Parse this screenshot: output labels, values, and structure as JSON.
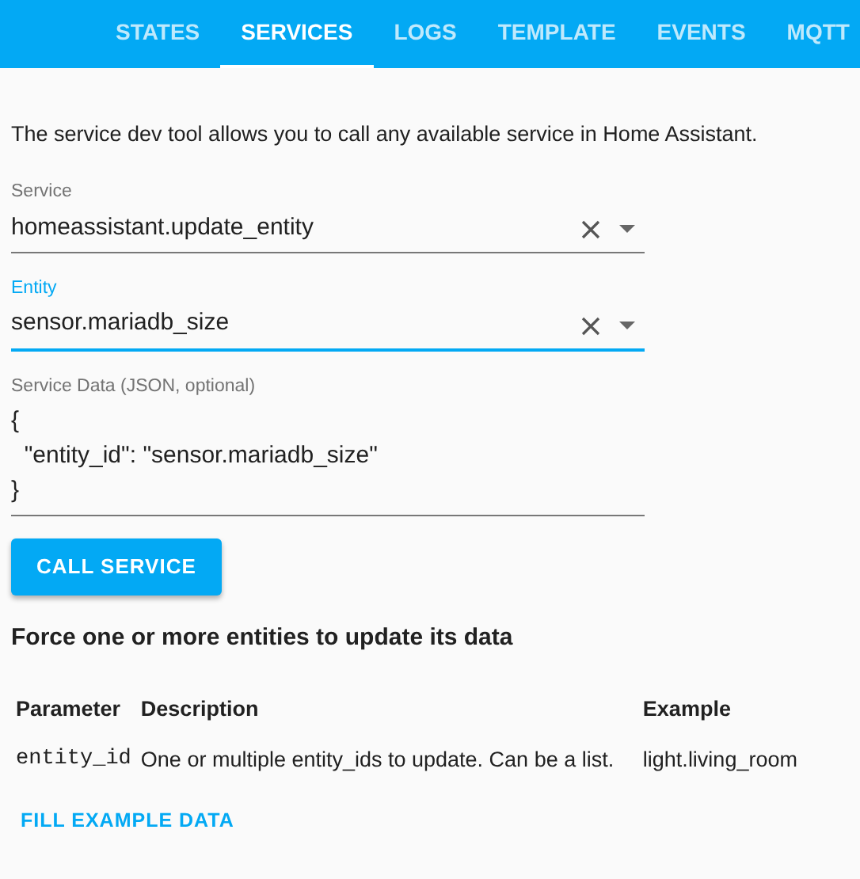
{
  "tabs": [
    {
      "label": "STATES",
      "selected": false
    },
    {
      "label": "SERVICES",
      "selected": true
    },
    {
      "label": "LOGS",
      "selected": false
    },
    {
      "label": "TEMPLATE",
      "selected": false
    },
    {
      "label": "EVENTS",
      "selected": false
    },
    {
      "label": "MQTT",
      "selected": false
    }
  ],
  "intro": "The service dev tool allows you to call any available service in Home Assistant.",
  "fields": [
    {
      "label": "Service",
      "value": "homeassistant.update_entity",
      "focused": false
    },
    {
      "label": "Entity",
      "value": "sensor.mariadb_size",
      "focused": true
    }
  ],
  "service_data": {
    "label": "Service Data (JSON, optional)",
    "value": "{\n  \"entity_id\": \"sensor.mariadb_size\"\n}"
  },
  "call_button": "CALL SERVICE",
  "description_title": "Force one or more entities to update its data",
  "table": {
    "columns": [
      "Parameter",
      "Description",
      "Example"
    ],
    "rows": [
      [
        "entity_id",
        "One or multiple entity_ids to update. Can be a list.",
        "light.living_room"
      ]
    ]
  },
  "fill_link": "FILL EXAMPLE DATA"
}
